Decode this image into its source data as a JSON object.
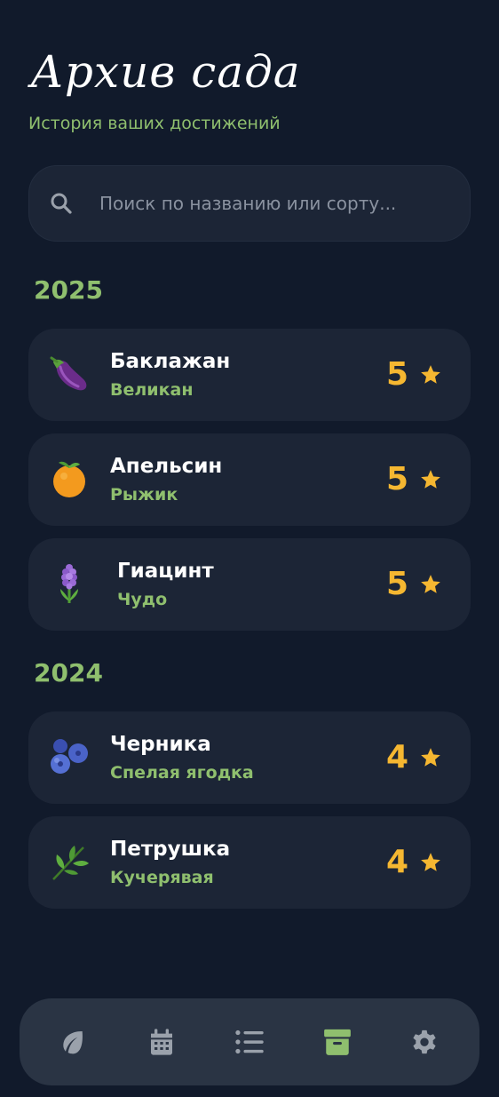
{
  "header": {
    "title": "Архив сада",
    "subtitle": "История ваших достижений"
  },
  "search": {
    "placeholder": "Поиск по названию или сорту..."
  },
  "colors": {
    "background": "#111a2b",
    "card": "#1c2536",
    "accent_green": "#8fbf6e",
    "rating_gold": "#f5b731",
    "nav_bg": "#2a3444",
    "nav_icon": "#9aa1ab"
  },
  "groups": [
    {
      "year": "2025",
      "items": [
        {
          "name": "Баклажан",
          "variety": "Великан",
          "rating": "5",
          "icon": "eggplant-icon"
        },
        {
          "name": "Апельсин",
          "variety": "Рыжик",
          "rating": "5",
          "icon": "tangerine-icon"
        },
        {
          "name": "Гиацинт",
          "variety": "Чудо",
          "rating": "5",
          "icon": "hyacinth-icon"
        }
      ]
    },
    {
      "year": "2024",
      "items": [
        {
          "name": "Черника",
          "variety": "Спелая ягодка",
          "rating": "4",
          "icon": "blueberries-icon"
        },
        {
          "name": "Петрушка",
          "variety": "Кучерявая",
          "rating": "4",
          "icon": "herb-icon"
        }
      ]
    }
  ],
  "nav": {
    "items": [
      {
        "icon": "leaf-icon",
        "active": false
      },
      {
        "icon": "calendar-icon",
        "active": false
      },
      {
        "icon": "list-icon",
        "active": false
      },
      {
        "icon": "archive-icon",
        "active": true
      },
      {
        "icon": "gear-icon",
        "active": false
      }
    ]
  }
}
